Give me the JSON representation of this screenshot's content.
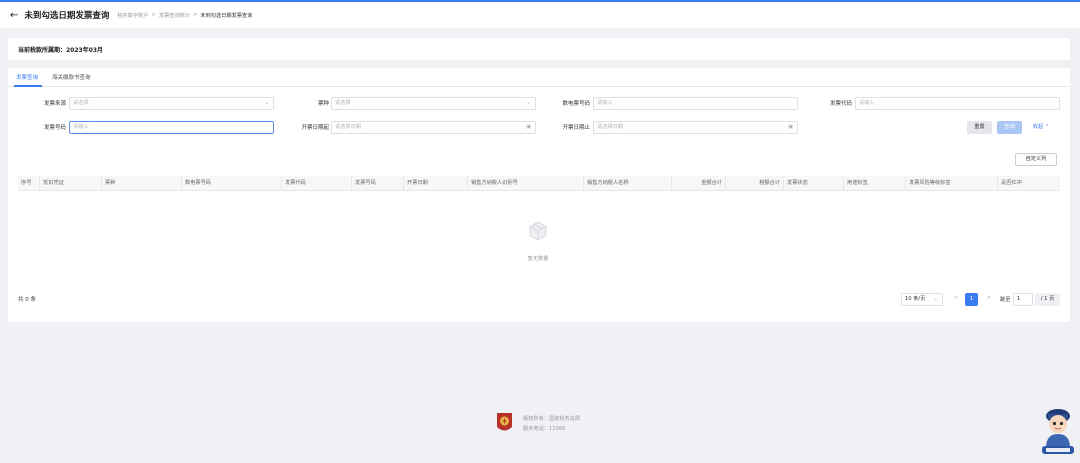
{
  "header": {
    "back_icon": "arrow-left-icon",
    "title": "未到勾选日期发票查询",
    "breadcrumbs": [
      "税务数字账户",
      "发票查询统计",
      "未到勾选日期发票查询"
    ]
  },
  "period": {
    "text": "当前税款所属期：2023年03月"
  },
  "tabs": [
    {
      "label": "发票查询",
      "active": true
    },
    {
      "label": "海关缴款书查询",
      "active": false
    }
  ],
  "filters": {
    "invoice_source": {
      "label": "发票来源",
      "placeholder": "请选择"
    },
    "invoice_type": {
      "label": "票种",
      "placeholder": "请选择"
    },
    "digital_invoice_no": {
      "label": "数电票号码",
      "placeholder": "请输入"
    },
    "invoice_code": {
      "label": "发票代码",
      "placeholder": "请输入"
    },
    "invoice_no": {
      "label": "发票号码",
      "placeholder": "请输入"
    },
    "date_start": {
      "label": "开票日期起",
      "placeholder": "请选择日期"
    },
    "date_end": {
      "label": "开票日期止",
      "placeholder": "请选择日期"
    }
  },
  "buttons": {
    "reset": "重置",
    "query": "查询",
    "collapse": "收起",
    "custom_columns": "自定义列"
  },
  "table": {
    "columns": [
      "序号",
      "抵扣凭证",
      "票种",
      "数电票号码",
      "发票代码",
      "发票号码",
      "开票日期",
      "销售方纳税人识别号",
      "销售方纳税人名称",
      "金额合计",
      "税额合计",
      "发票状态",
      "用途标签",
      "发票风险等级标签",
      "是否红冲"
    ],
    "empty_text": "暂无数据"
  },
  "pagination": {
    "total_text": "共 0 条",
    "page_size": "10 条/页",
    "current_page": "1",
    "jump_label": "跳至",
    "jump_value": "1",
    "total_pages": "/ 1 页"
  },
  "footer": {
    "sponsor": "版权所有：国家税务总局",
    "hotline": "服务电话：12366"
  },
  "colors": {
    "accent": "#3a7cf2",
    "background": "#f0f1f4"
  }
}
